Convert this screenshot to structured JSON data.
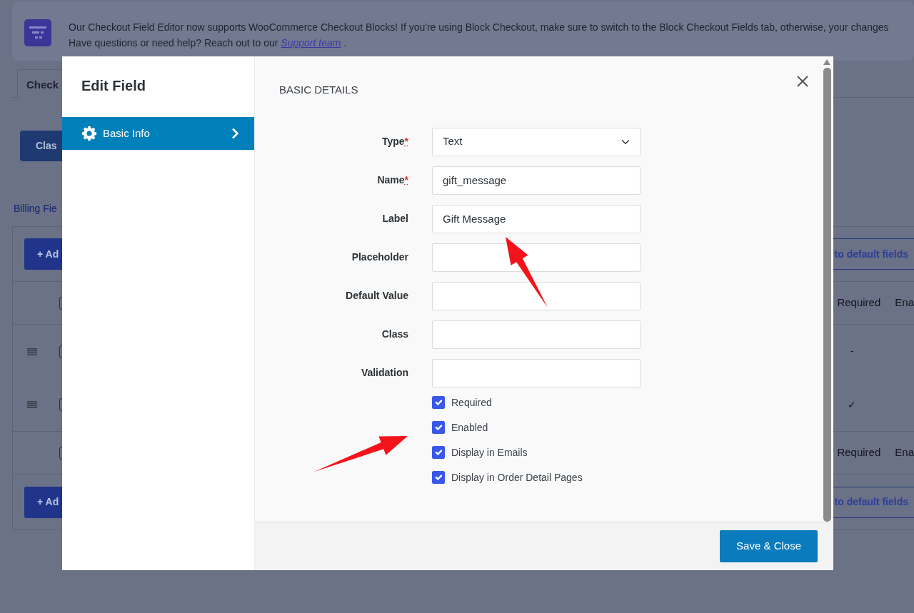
{
  "notice": {
    "text": "Our Checkout Field Editor now supports WooCommerce Checkout Blocks! If you're using Block Checkout, make sure to switch to the Block Checkout Fields tab, otherwise, your changes",
    "help_text": "Have questions or need help? Reach out to our",
    "link": "Support team",
    "after_link": "."
  },
  "tabs": [
    {
      "label": "Check",
      "selected": true
    }
  ],
  "mode_button": "Clas",
  "section_link": "Billing Fie",
  "fields_table": {
    "top_actions": {
      "add": "+ Ad",
      "reset": "to default fields"
    },
    "header": {
      "select_all_checked": false,
      "columns": [
        "Required",
        "Ena"
      ]
    },
    "rows": [
      {
        "checked": false,
        "required": "-"
      },
      {
        "checked": false,
        "required": "✓"
      }
    ],
    "footer": {
      "select_all_checked": false,
      "columns": [
        "Required",
        "Ena"
      ]
    },
    "bottom_actions": {
      "add": "+ Ad",
      "reset": "to default fields"
    }
  },
  "modal": {
    "title": "Edit Field",
    "menu": [
      {
        "label": "Basic Info",
        "selected": true
      }
    ],
    "section_title": "BASIC DETAILS",
    "fields": [
      {
        "kind": "select",
        "label": "Type",
        "required_mark": "*",
        "value": "Text"
      },
      {
        "kind": "text",
        "label": "Name",
        "required_mark": "*",
        "value": "gift_message"
      },
      {
        "kind": "text",
        "label": "Label",
        "value": "Gift Message"
      },
      {
        "kind": "text",
        "label": "Placeholder"
      },
      {
        "kind": "text",
        "label": "Default Value"
      },
      {
        "kind": "text",
        "label": "Class"
      },
      {
        "kind": "text",
        "label": "Validation"
      }
    ],
    "options": [
      {
        "label": "Required",
        "checked": true
      },
      {
        "label": "Enabled",
        "checked": true
      },
      {
        "label": "Display in Emails",
        "checked": true
      },
      {
        "label": "Display in Order Detail Pages",
        "checked": true
      }
    ],
    "save_button": "Save & Close"
  }
}
